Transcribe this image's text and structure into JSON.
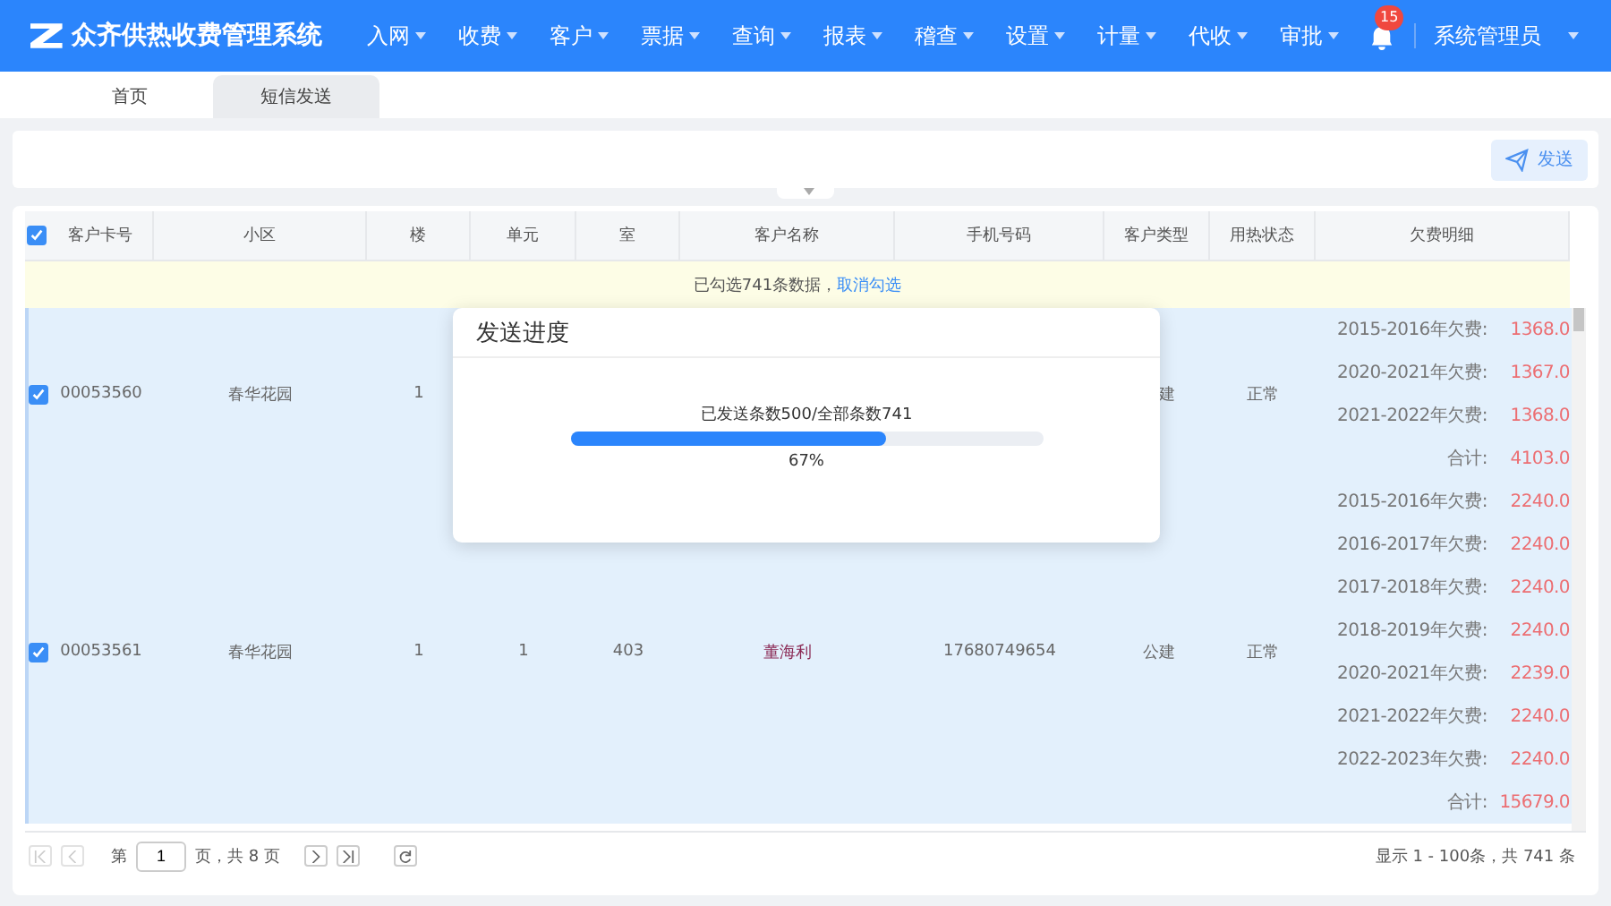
{
  "header": {
    "app_title": "众齐供热收费管理系统",
    "menu": [
      {
        "label": "入网"
      },
      {
        "label": "收费"
      },
      {
        "label": "客户"
      },
      {
        "label": "票据"
      },
      {
        "label": "查询"
      },
      {
        "label": "报表"
      },
      {
        "label": "稽查"
      },
      {
        "label": "设置"
      },
      {
        "label": "计量"
      },
      {
        "label": "代收"
      },
      {
        "label": "审批"
      }
    ],
    "notification_count": "15",
    "user": "系统管理员"
  },
  "tabs": [
    {
      "label": "首页",
      "selected": false
    },
    {
      "label": "短信发送",
      "selected": true
    }
  ],
  "toolbar": {
    "send_button": "发送"
  },
  "table": {
    "select_all_checked": true,
    "columns": [
      "客户卡号",
      "小区",
      "楼",
      "单元",
      "室",
      "客户名称",
      "手机号码",
      "客户类型",
      "用热状态",
      "欠费明细"
    ],
    "selection_notice": {
      "text": "已勾选741条数据，",
      "link": "取消勾选"
    },
    "rows": [
      {
        "checked": true,
        "card": "00053560",
        "community": "春华花园",
        "building": "1",
        "type": "建",
        "status": "正常",
        "arrears": [
          {
            "label": "2015-2016年欠费:",
            "amount": "1368.0"
          },
          {
            "label": "2020-2021年欠费:",
            "amount": "1367.0"
          },
          {
            "label": "2021-2022年欠费:",
            "amount": "1368.0"
          },
          {
            "label": "合计:",
            "amount": "4103.0"
          }
        ]
      },
      {
        "checked": true,
        "card": "00053561",
        "community": "春华花园",
        "building": "1",
        "unit": "1",
        "room": "403",
        "name": "董海利",
        "phone": "17680749654",
        "type": "公建",
        "status": "正常",
        "arrears": [
          {
            "label": "2015-2016年欠费:",
            "amount": "2240.0"
          },
          {
            "label": "2016-2017年欠费:",
            "amount": "2240.0"
          },
          {
            "label": "2017-2018年欠费:",
            "amount": "2240.0"
          },
          {
            "label": "2018-2019年欠费:",
            "amount": "2240.0"
          },
          {
            "label": "2020-2021年欠费:",
            "amount": "2239.0"
          },
          {
            "label": "2021-2022年欠费:",
            "amount": "2240.0"
          },
          {
            "label": "2022-2023年欠费:",
            "amount": "2240.0"
          },
          {
            "label": "合计:",
            "amount": "15679.0"
          }
        ]
      }
    ]
  },
  "pager": {
    "page_prefix": "第",
    "page_value": "1",
    "page_suffix": "页，共 8 页",
    "summary": "显示 1 - 100条，共 741 条"
  },
  "modal": {
    "title": "发送进度",
    "progress_text": "已发送条数500/全部条数741",
    "level": 0.67,
    "percent": "67%"
  }
}
